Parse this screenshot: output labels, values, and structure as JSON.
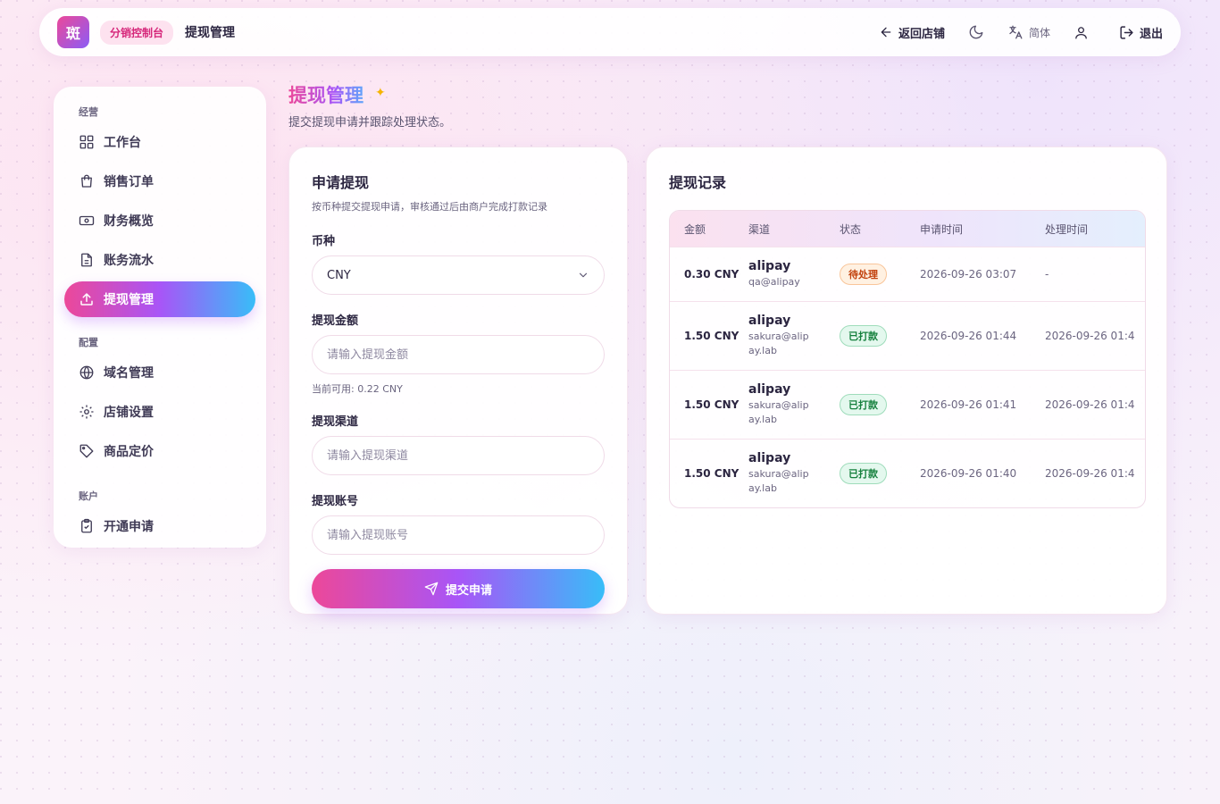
{
  "app": {
    "logo_text": "斑",
    "brand_pill": "分销控制台",
    "title": "提现管理"
  },
  "top_actions": {
    "back": "返回店铺",
    "language": "简体",
    "logout": "退出"
  },
  "sidebar": {
    "groups": [
      {
        "label": "经营",
        "items": [
          {
            "label": "工作台",
            "icon": "grid-icon"
          },
          {
            "label": "销售订单",
            "icon": "shopping-bag-icon"
          },
          {
            "label": "财务概览",
            "icon": "banknote-icon"
          },
          {
            "label": "账务流水",
            "icon": "file-text-icon"
          },
          {
            "label": "提现管理",
            "icon": "upload-icon",
            "active": true
          }
        ]
      },
      {
        "label": "配置",
        "items": [
          {
            "label": "域名管理",
            "icon": "globe-icon"
          },
          {
            "label": "店铺设置",
            "icon": "gear-icon"
          },
          {
            "label": "商品定价",
            "icon": "tag-icon"
          }
        ]
      },
      {
        "label": "账户",
        "items": [
          {
            "label": "开通申请",
            "icon": "clipboard-check-icon"
          }
        ]
      }
    ]
  },
  "page": {
    "title": "提现管理",
    "subtitle": "提交提现申请并跟踪处理状态。"
  },
  "apply_form": {
    "title": "申请提现",
    "description": "按币种提交提现申请，审核通过后由商户完成打款记录",
    "currency_label": "币种",
    "currency_value": "CNY",
    "amount_label": "提现金额",
    "amount_placeholder": "请输入提现金额",
    "available_hint": "当前可用: 0.22 CNY",
    "channel_label": "提现渠道",
    "channel_placeholder": "请输入提现渠道",
    "account_label": "提现账号",
    "account_placeholder": "请输入提现账号",
    "submit_label": "提交申请"
  },
  "records": {
    "title": "提现记录",
    "columns": [
      "金额",
      "渠道",
      "状态",
      "申请时间",
      "处理时间"
    ],
    "rows": [
      {
        "amount": "0.30 CNY",
        "channel": "alipay",
        "account": "qa@alipay",
        "status": "待处理",
        "status_type": "pending",
        "applied_at": "2026-09-26 03:07",
        "processed_at": "-"
      },
      {
        "amount": "1.50 CNY",
        "channel": "alipay",
        "account": "sakura@alipay.lab",
        "status": "已打款",
        "status_type": "paid",
        "applied_at": "2026-09-26 01:44",
        "processed_at": "2026-09-26 01:4"
      },
      {
        "amount": "1.50 CNY",
        "channel": "alipay",
        "account": "sakura@alipay.lab",
        "status": "已打款",
        "status_type": "paid",
        "applied_at": "2026-09-26 01:41",
        "processed_at": "2026-09-26 01:4"
      },
      {
        "amount": "1.50 CNY",
        "channel": "alipay",
        "account": "sakura@alipay.lab",
        "status": "已打款",
        "status_type": "paid",
        "applied_at": "2026-09-26 01:40",
        "processed_at": "2026-09-26 01:4"
      }
    ]
  },
  "colors": {
    "accent_pink": "#ec4899",
    "accent_purple": "#a855f7",
    "accent_blue": "#38bdf8",
    "pending": "#c2410c",
    "paid": "#15803d"
  }
}
